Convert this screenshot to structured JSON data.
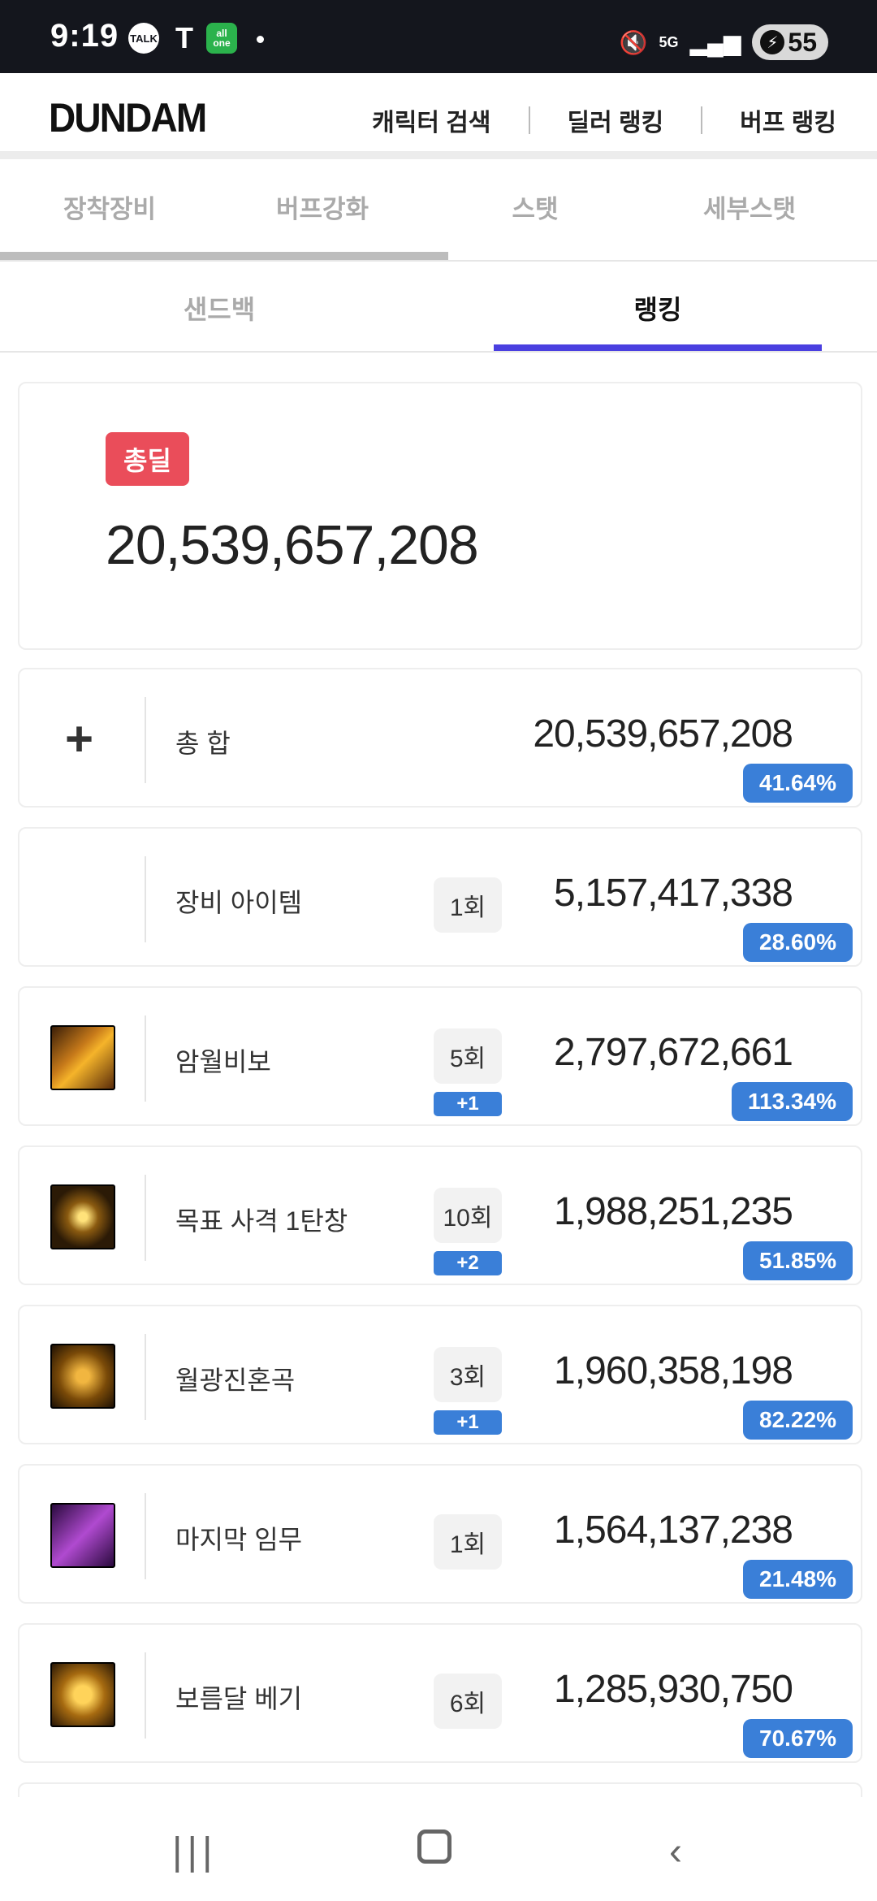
{
  "status_bar": {
    "time": "9:19",
    "battery": "55",
    "talk": "TALK",
    "t_icon": "T",
    "allone_top": "all",
    "allone_bottom": "one"
  },
  "header": {
    "logo": "DUNDAM",
    "nav": [
      "캐릭터 검색",
      "딜러 랭킹",
      "버프 랭킹"
    ]
  },
  "tabs_primary": [
    "장착장비",
    "버프강화",
    "스탯",
    "세부스탯"
  ],
  "tabs_secondary": {
    "inactive": "샌드백",
    "active": "랭킹"
  },
  "total_card": {
    "badge": "총딜",
    "value": "20,539,657,208"
  },
  "rows": [
    {
      "name": "총 합",
      "count": "",
      "bonus": "",
      "value": "20,539,657,208",
      "percent": "41.64%"
    },
    {
      "name": "장비 아이템",
      "count": "1회",
      "bonus": "",
      "value": "5,157,417,338",
      "percent": "28.60%"
    },
    {
      "name": "암월비보",
      "count": "5회",
      "bonus": "+1",
      "value": "2,797,672,661",
      "percent": "113.34%"
    },
    {
      "name": "목표 사격 1탄창",
      "count": "10회",
      "bonus": "+2",
      "value": "1,988,251,235",
      "percent": "51.85%"
    },
    {
      "name": "월광진혼곡",
      "count": "3회",
      "bonus": "+1",
      "value": "1,960,358,198",
      "percent": "82.22%"
    },
    {
      "name": "마지막 임무",
      "count": "1회",
      "bonus": "",
      "value": "1,564,137,238",
      "percent": "21.48%"
    },
    {
      "name": "보름달 베기",
      "count": "6회",
      "bonus": "",
      "value": "1,285,930,750",
      "percent": "70.67%"
    }
  ],
  "icons": {
    "plus": "plus-icon",
    "skill_icons": [
      "amwol-bibo-skill-icon",
      "target-shot-skill-icon",
      "moonlight-requiem-skill-icon",
      "last-mission-skill-icon",
      "full-moon-slash-skill-icon"
    ]
  },
  "colors": {
    "accent": "#4a3fe0",
    "badge_red": "#ea4d5a",
    "percent_blue": "#3a7fd8"
  }
}
